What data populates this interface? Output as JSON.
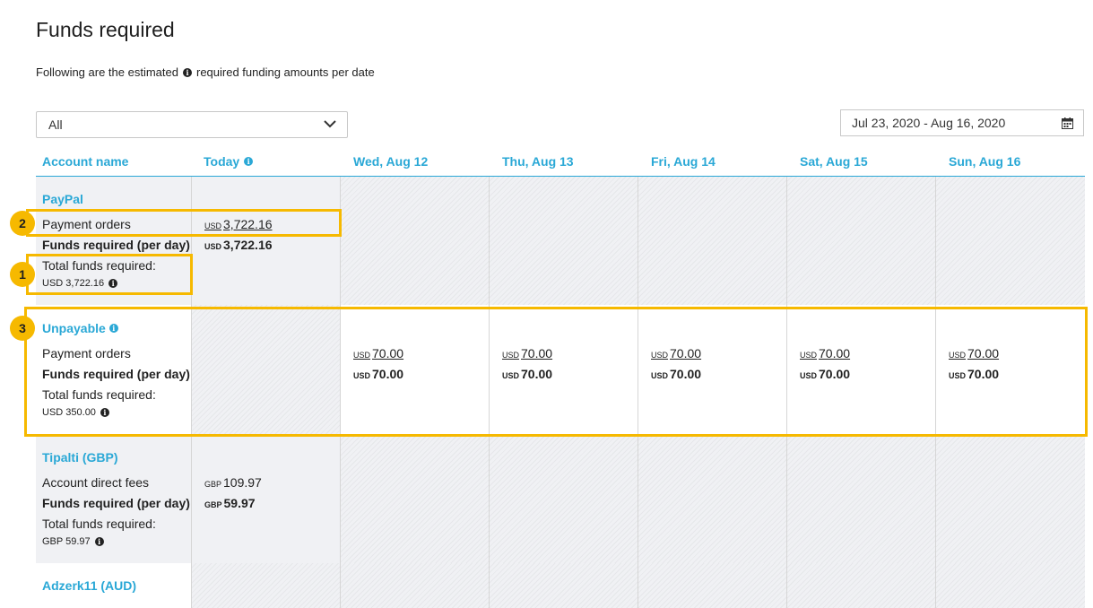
{
  "page": {
    "title": "Funds required",
    "subtitle_before": "Following are the estimated",
    "subtitle_after": "required funding amounts per date"
  },
  "filter": {
    "selected": "All",
    "icon": "chevron-down-icon"
  },
  "date_range": {
    "value": "Jul 23, 2020 - Aug 16, 2020",
    "icon": "calendar-icon"
  },
  "columns": {
    "account_name": "Account name",
    "today": "Today",
    "days": [
      "Wed, Aug 12",
      "Thu, Aug 13",
      "Fri, Aug 14",
      "Sat, Aug 15",
      "Sun, Aug 16"
    ]
  },
  "rows": [
    {
      "name": "PayPal",
      "line1": "Payment orders",
      "line2": "Funds required (per day)",
      "line3": "Total funds required:",
      "total": "USD 3,722.16",
      "today_cur": "USD",
      "today_line1": "3,722.16",
      "today_line2": "3,722.16"
    },
    {
      "name": "Unpayable",
      "line1": "Payment orders",
      "line2": "Funds required (per day)",
      "line3": "Total funds required:",
      "total": "USD 350.00",
      "day_cur": "USD",
      "day_line1": "70.00",
      "day_line2": "70.00"
    },
    {
      "name": "Tipalti (GBP)",
      "line1": "Account direct fees",
      "line2": "Funds required (per day)",
      "line3": "Total funds required:",
      "total": "GBP 59.97",
      "today_cur": "GBP",
      "today_line1": "109.97",
      "today_line2": "59.97"
    },
    {
      "name": "Adzerk11 (AUD)"
    }
  ],
  "callouts": [
    "1",
    "2",
    "3"
  ],
  "colors": {
    "accent": "#2aa8d6",
    "highlight": "#f6b900",
    "grey_cell": "#f0f1f4"
  }
}
